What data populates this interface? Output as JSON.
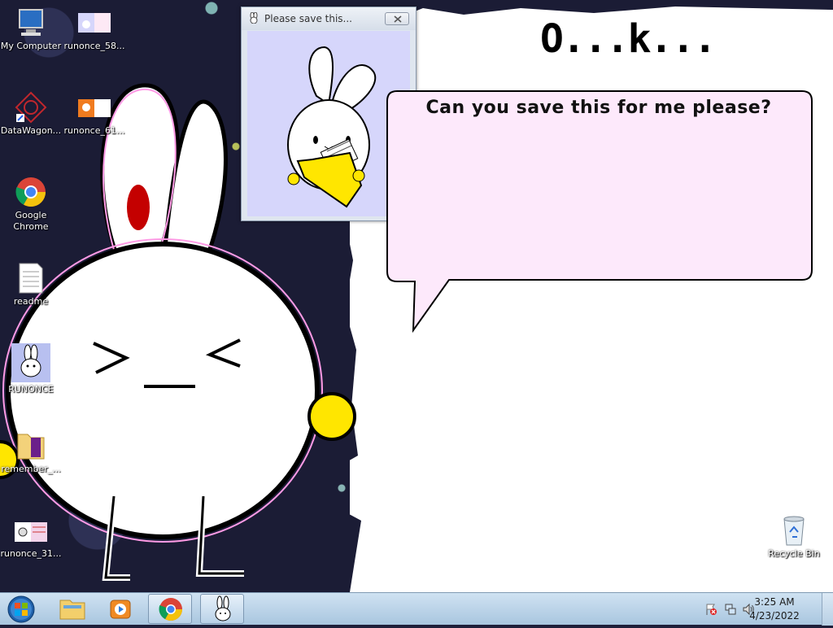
{
  "desktop_icons": [
    {
      "label": "My Computer",
      "icon": "computer-icon"
    },
    {
      "label": "runonce_58...",
      "icon": "image-thumbnail-icon"
    },
    {
      "label": "DataWagon...",
      "icon": "shortcut-icon"
    },
    {
      "label": "runonce_61...",
      "icon": "image-thumbnail-icon"
    },
    {
      "label": "Google\nChrome",
      "icon": "chrome-icon"
    },
    {
      "label": "readme",
      "icon": "text-file-icon"
    },
    {
      "label": "RUNONCE",
      "icon": "bunny-app-icon"
    },
    {
      "label": "remember_...",
      "icon": "folder-icon"
    },
    {
      "label": "runonce_31...",
      "icon": "image-thumbnail-icon"
    },
    {
      "label": "Recycle Bin",
      "icon": "recycle-bin-icon"
    }
  ],
  "window": {
    "title": "Please save this...",
    "close_icon": "close-icon"
  },
  "ok_text": "O...k...",
  "speech_bubble": {
    "text": "Can you save this for me please?",
    "fill": "#fde9fb"
  },
  "taskbar": {
    "items": [
      "start-orb-icon",
      "explorer-icon",
      "media-player-icon",
      "chrome-icon",
      "bunny-app-icon"
    ],
    "clock": {
      "time": "3:25 AM",
      "date": "4/23/2022"
    },
    "tray_icons": [
      "action-center-flag-icon",
      "network-icon",
      "volume-icon"
    ]
  },
  "colors": {
    "taskbar": "#b9d2e8",
    "window_body": "#d6d6fb",
    "bunny_yellow": "#ffe600"
  }
}
